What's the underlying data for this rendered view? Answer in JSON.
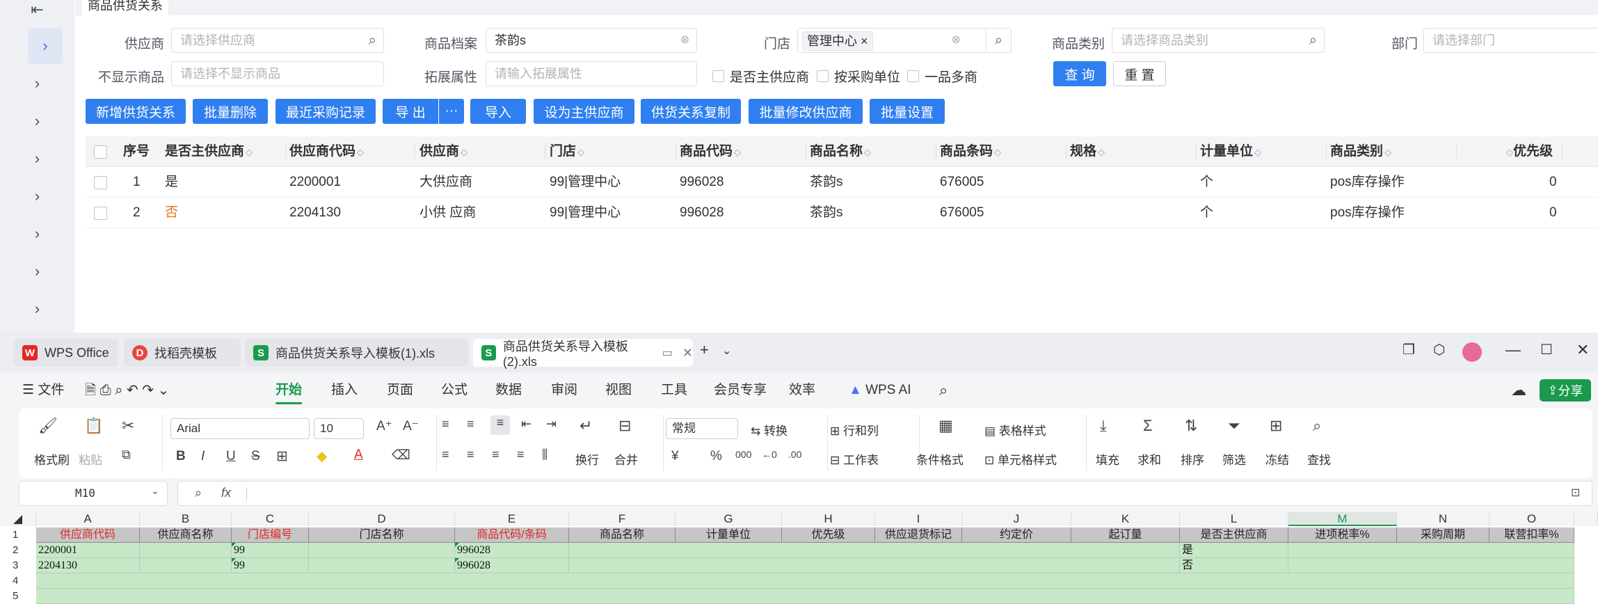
{
  "web": {
    "page_tab": "商品供货关系",
    "collapse_icon": "collapse-left-icon",
    "filters": {
      "supplier_label": "供应商",
      "supplier_placeholder": "请选择供应商",
      "product_label": "商品档案",
      "product_value": "茶韵s",
      "store_label": "门店",
      "store_tag": "管理中心",
      "category_label": "商品类别",
      "category_placeholder": "请选择商品类别",
      "dept_label": "部门",
      "dept_placeholder": "请选择部门",
      "hide_label": "不显示商品",
      "hide_placeholder": "请选择不显示商品",
      "ext_label": "拓展属性",
      "ext_placeholder": "请输入拓展属性",
      "chk_main": "是否主供应商",
      "chk_purchase_unit": "按采购单位",
      "chk_multi": "一品多商",
      "query": "查 询",
      "reset": "重 置"
    },
    "toolbar": {
      "add": "新增供货关系",
      "batch_delete": "批量删除",
      "recent": "最近采购记录",
      "export": "导 出",
      "more": "···",
      "import": "导入",
      "set_main": "设为主供应商",
      "copy": "供货关系复制",
      "batch_modify": "批量修改供应商",
      "batch_set": "批量设置"
    },
    "table": {
      "headers": [
        "序号",
        "是否主供应商",
        "供应商代码",
        "供应商",
        "门店",
        "商品代码",
        "商品名称",
        "商品条码",
        "规格",
        "计量单位",
        "商品类别",
        "优先级"
      ],
      "rows": [
        [
          "1",
          "是",
          "2200001",
          "大供应商",
          "99|管理中心",
          "996028",
          "茶韵s",
          "676005",
          "",
          "个",
          "pos库存操作",
          "0"
        ],
        [
          "2",
          "否",
          "2204130",
          "小供 应商",
          "99|管理中心",
          "996028",
          "茶韵s",
          "676005",
          "",
          "个",
          "pos库存操作",
          "0"
        ]
      ]
    }
  },
  "wps": {
    "tabs": [
      {
        "label": "WPS Office",
        "icon": "wps-logo-icon"
      },
      {
        "label": "找稻壳模板",
        "icon": "docer-icon"
      },
      {
        "label": "商品供货关系导入模板(1).xls",
        "icon": "sheet-icon"
      },
      {
        "label": "商品供货关系导入模板(2).xls",
        "icon": "sheet-icon"
      }
    ],
    "menu": [
      "文件",
      "开始",
      "插入",
      "页面",
      "公式",
      "数据",
      "审阅",
      "视图",
      "工具",
      "会员专享",
      "效率",
      "WPS AI"
    ],
    "share": "分享",
    "ribbon": {
      "format_painter": "格式刷",
      "paste": "粘贴",
      "font": "Arial",
      "size": "10",
      "wrap": "换行",
      "merge": "合并",
      "number_format": "常规",
      "convert": "转换",
      "rowcol": "行和列",
      "worksheet": "工作表",
      "cond_format": "条件格式",
      "table_style": "表格样式",
      "cell_style": "单元格样式",
      "fill": "填充",
      "sum": "求和",
      "sort": "排序",
      "filter": "筛选",
      "freeze": "冻结",
      "find": "查找",
      "b": "B",
      "i": "I",
      "u": "U",
      "s": "S",
      "a_big": "A",
      "yen": "¥",
      "pct": "%"
    },
    "name_box": "M10",
    "fx": "fx",
    "columns": [
      "A",
      "B",
      "C",
      "D",
      "E",
      "F",
      "G",
      "H",
      "I",
      "J",
      "K",
      "L",
      "M",
      "N",
      "O"
    ],
    "rows_nums": [
      "1",
      "2",
      "3",
      "4",
      "5"
    ],
    "header_row": [
      "供应商代码",
      "供应商名称",
      "门店编号",
      "门店名称",
      "商品代码/条码",
      "商品名称",
      "计量单位",
      "优先级",
      "供应退货标记",
      "约定价",
      "起订量",
      "是否主供应商",
      "进项税率%",
      "采购周期",
      "联营扣率%"
    ],
    "data_rows": [
      [
        "2200001",
        "",
        "99",
        "",
        "996028",
        "",
        "",
        "",
        "",
        "",
        "",
        "是",
        "",
        "",
        ""
      ],
      [
        "2204130",
        "",
        "99",
        "",
        "996028",
        "",
        "",
        "",
        "",
        "",
        "",
        "否",
        "",
        "",
        ""
      ]
    ],
    "colors": {
      "accent": "#1a9a4c",
      "header_bg": "#c6c6c6",
      "data_bg": "#c6e8c6",
      "red": "#e32626"
    }
  }
}
